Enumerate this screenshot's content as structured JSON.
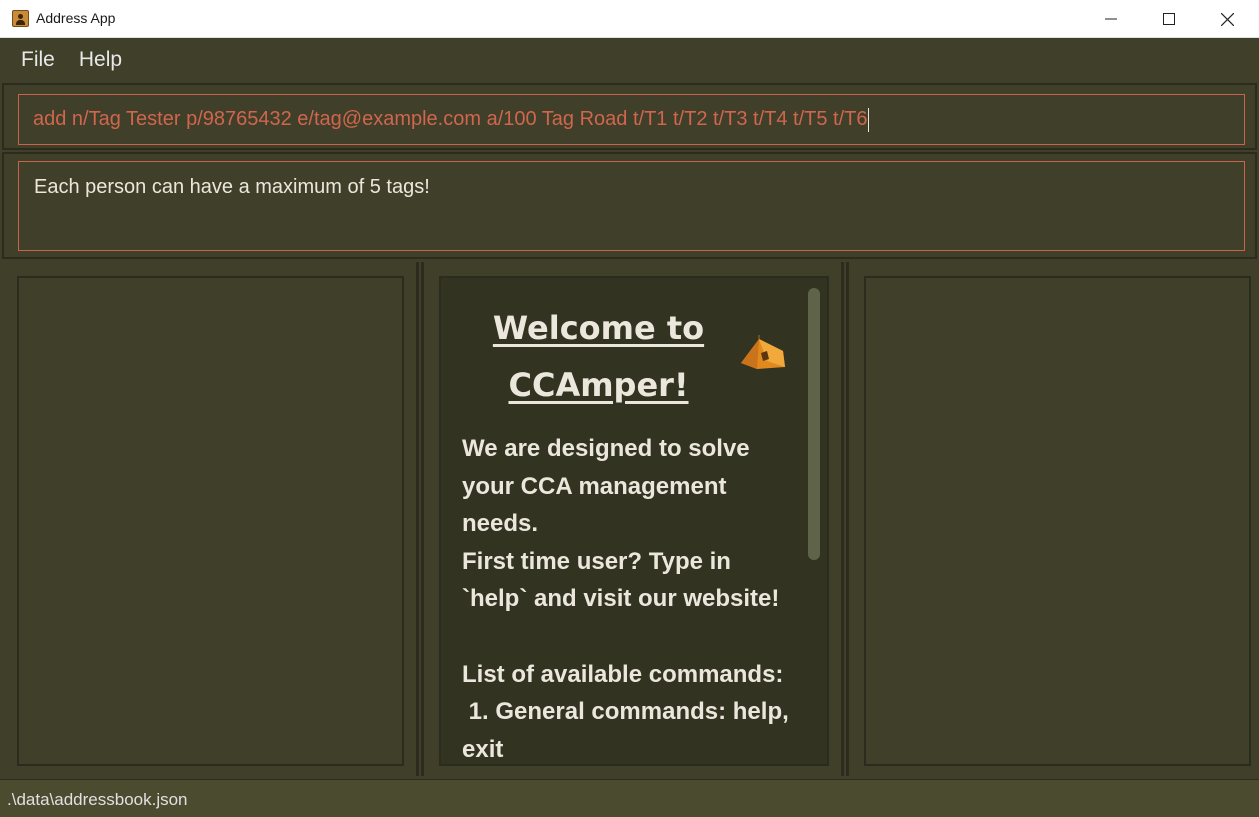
{
  "window": {
    "title": "Address App",
    "controls": {
      "minimize": "—",
      "maximize": "☐",
      "close": "✕"
    }
  },
  "menu": {
    "items": [
      "File",
      "Help"
    ]
  },
  "command": {
    "value": "add n/Tag Tester p/98765432 e/tag@example.com a/100 Tag Road t/T1 t/T2 t/T3 t/T4 t/T5 t/T6"
  },
  "result": {
    "message": "Each person can have a maximum of 5 tags!"
  },
  "welcome": {
    "title": "Welcome to CCAmper!",
    "body": "We are designed to solve your CCA management needs.\nFirst time user? Type in `help` and visit our website!\n\nList of available commands:\n 1. General commands: help, exit",
    "icon": "tent-icon"
  },
  "status": {
    "path": ".\\data\\addressbook.json"
  },
  "colors": {
    "background": "#3f3f2a",
    "accent_border": "#c9634b",
    "command_text": "#d0664d",
    "text": "#ece7dc"
  }
}
